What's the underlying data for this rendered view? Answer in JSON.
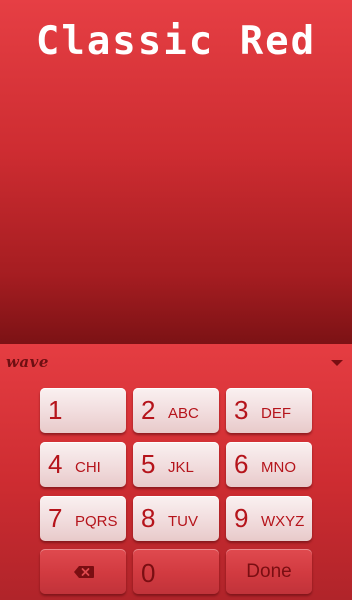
{
  "theme": {
    "title": "Classic Red"
  },
  "keyboard": {
    "brand": "wave",
    "collapse_icon": "chevron-down-icon",
    "keys": [
      {
        "digit": "1",
        "letters": ""
      },
      {
        "digit": "2",
        "letters": "ABC"
      },
      {
        "digit": "3",
        "letters": "DEF"
      },
      {
        "digit": "4",
        "letters": "CHI"
      },
      {
        "digit": "5",
        "letters": "JKL"
      },
      {
        "digit": "6",
        "letters": "MNO"
      },
      {
        "digit": "7",
        "letters": "PQRS"
      },
      {
        "digit": "8",
        "letters": "TUV"
      },
      {
        "digit": "9",
        "letters": "WXYZ"
      },
      {
        "digit": "0",
        "letters": ""
      }
    ],
    "backspace_icon": "backspace-icon",
    "done_label": "Done"
  },
  "colors": {
    "accent_red": "#cd2c31",
    "key_text": "#b5141b",
    "key_face": "#f3e2e2",
    "dark_text": "#7a0e12"
  }
}
